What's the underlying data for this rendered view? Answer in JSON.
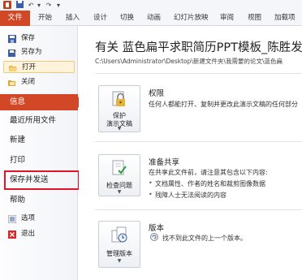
{
  "ribbon": {
    "file_tab": "文件",
    "tabs": [
      "开始",
      "插入",
      "设计",
      "切换",
      "动画",
      "幻灯片放映",
      "审阅",
      "视图",
      "加载项"
    ]
  },
  "commands": {
    "save": "保存",
    "save_as": "另存为",
    "open": "打开",
    "close": "关闭"
  },
  "nav": {
    "info": "信息",
    "recent": "最近所用文件",
    "new": "新建",
    "print": "打印",
    "save_send": "保存并发送",
    "help": "帮助"
  },
  "bottom_commands": {
    "options": "选项",
    "exit": "退出"
  },
  "document": {
    "title": "有关 蓝色扁平求职简历PPT模板_陈胜发",
    "path": "C:\\Users\\Administrator\\Desktop\\新建文件夹\\我需要的论文\\蓝色扁"
  },
  "sections": {
    "permissions": {
      "button_line1": "保护",
      "button_line2": "演示文稿",
      "title": "权限",
      "text": "任何人都能打开、复制并更改此演示文稿的任何部分"
    },
    "prepare": {
      "button_label": "检查问题",
      "title": "准备共享",
      "text": "在共享此文件前，请注意其包含以下内容:",
      "bullets": [
        "文档属性、作者的姓名和裁剪图像数据",
        "残障人士无法阅读的内容"
      ]
    },
    "versions": {
      "button_label": "管理版本",
      "title": "版本",
      "text": "找不到此文件的上一个版本。"
    }
  },
  "colors": {
    "accent": "#d24726",
    "highlight_box": "#e0152a"
  }
}
